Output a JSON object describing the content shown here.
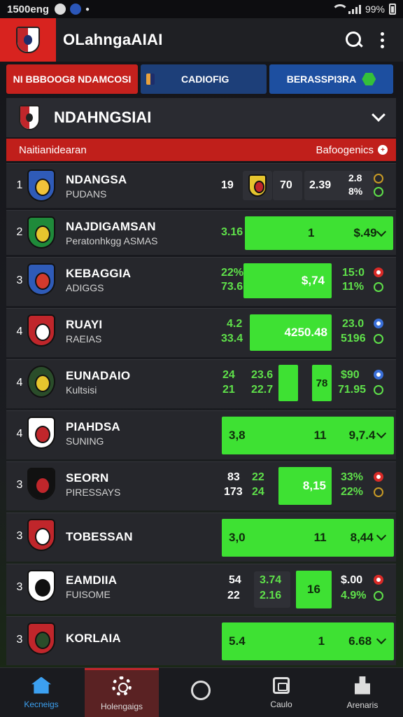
{
  "status": {
    "time": "1500eng",
    "battery": "99%"
  },
  "appbar": {
    "title": "OLahngaAIAI"
  },
  "tabs": [
    {
      "label": "NI BBBOOG8 NDAMCOSI"
    },
    {
      "label": "CADIOFIG"
    },
    {
      "label": "BERASSPI3RA"
    }
  ],
  "league": {
    "name": "NDAHNGSIAI"
  },
  "subheader": {
    "left": "Naitianidearan",
    "right": "Bafoogenics"
  },
  "rows": [
    {
      "rank": "1",
      "name": "NDANGSA",
      "sub": "PUDANS",
      "c1": "19",
      "c2": "70",
      "c3": "2.39",
      "c4a": "2.8",
      "c4b": "8%",
      "colors": [
        "#2f5bb8",
        "#f0c23a"
      ]
    },
    {
      "rank": "2",
      "name": "NAJDIGAMSAN",
      "sub": "Peratonhkgg ASMAS",
      "c1": "3.16",
      "box1": "1",
      "box2": "$.49",
      "colors": [
        "#1f8a3a",
        "#e6c52e"
      ]
    },
    {
      "rank": "3",
      "name": "KEBAGGIA",
      "sub": "ADIGGS",
      "c1a": "22%",
      "c1b": "73.6",
      "box1": "$,74",
      "c4a": "15:0",
      "c4b": "11%",
      "colors": [
        "#2f5bb8",
        "#d33a2c"
      ]
    },
    {
      "rank": "4",
      "name": "RUAYI",
      "sub": "RAEIAS",
      "c1a": "4.2",
      "c1b": "33.4",
      "box1": "4250.48",
      "c4a": "23.0",
      "c4b": "5196",
      "colors": [
        "#c0262b",
        "#ffffff"
      ]
    },
    {
      "rank": "4",
      "name": "EUNADAIO",
      "sub": "Kultsisi",
      "c1a": "24",
      "c1b": "21",
      "c2a": "23.6",
      "c2b": "22.7",
      "box1": "78",
      "c4a": "$90",
      "c4b": "71.95",
      "colors": [
        "#2a4d2a",
        "#e6c52e"
      ]
    },
    {
      "rank": "4",
      "name": "PIAHDSA",
      "sub": "SUNING",
      "box1": "3,8",
      "box2": "11",
      "box3": "9,7.4",
      "colors": [
        "#ffffff",
        "#c0262b"
      ]
    },
    {
      "rank": "3",
      "name": "SEORN",
      "sub": "PIRESSAYS",
      "c1a": "83",
      "c1b": "173",
      "c2a": "22",
      "c2b": "24",
      "box1": "8,15",
      "c4a": "33%",
      "c4b": "22%",
      "colors": [
        "#111111",
        "#c0262b"
      ]
    },
    {
      "rank": "3",
      "name": "TOBESSAN",
      "sub": "",
      "box1": "3,0",
      "box2": "11",
      "box3": "8,44",
      "colors": [
        "#c0262b",
        "#ffffff"
      ]
    },
    {
      "rank": "3",
      "name": "EAMDIIA",
      "sub": "FUISOME",
      "c1a": "54",
      "c1b": "22",
      "c2a": "3.74",
      "c2b": "2.16",
      "box1": "16",
      "c4a": "$.00",
      "c4b": "4.9%",
      "colors": [
        "#ffffff",
        "#111111"
      ]
    },
    {
      "rank": "3",
      "name": "KORLAIA",
      "sub": "",
      "box1": "5.4",
      "box2": "1",
      "box3": "6.68",
      "colors": [
        "#c0262b",
        "#2a4d2a"
      ]
    }
  ],
  "nav": [
    {
      "label": "Kecneigs"
    },
    {
      "label": "Holengaigs"
    },
    {
      "label": ""
    },
    {
      "label": "Caulo"
    },
    {
      "label": "Arenaris"
    }
  ]
}
